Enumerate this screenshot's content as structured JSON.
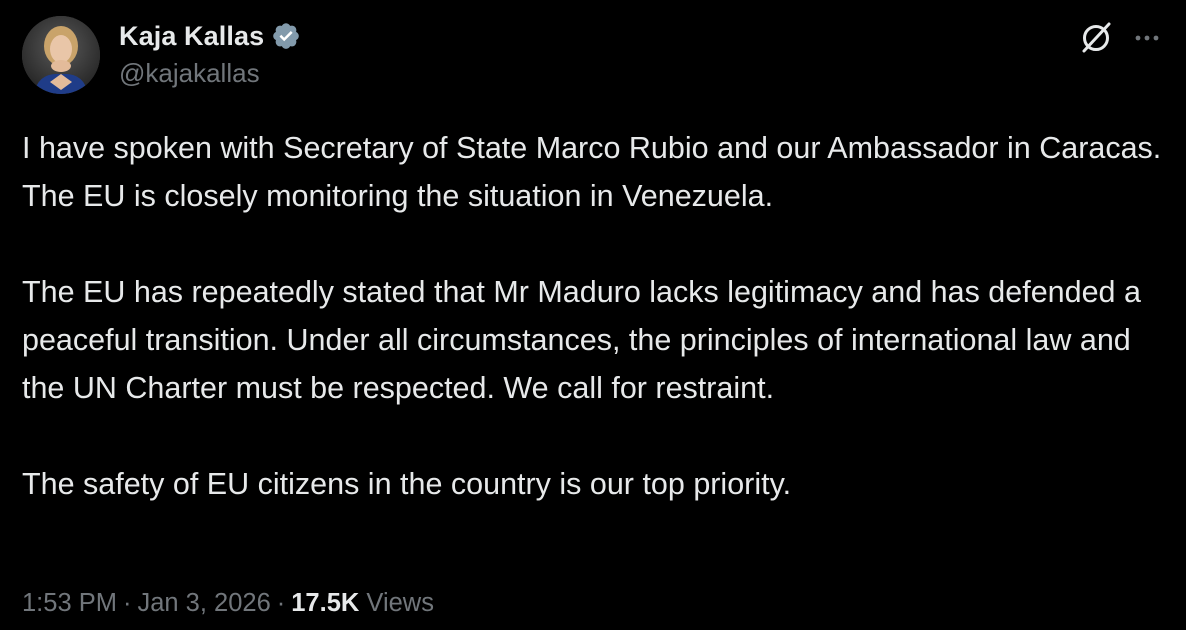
{
  "author": {
    "display_name": "Kaja Kallas",
    "handle": "@kajakallas",
    "verified": true
  },
  "tweet": {
    "paragraphs": [
      "I have spoken with Secretary of State Marco Rubio and our Ambassador in Caracas. The EU is closely monitoring the situation in Venezuela.",
      "The EU has repeatedly stated that Mr Maduro lacks legitimacy and has defended a peaceful transition. Under all circumstances, the principles of international law and the UN Charter must be respected. We call for restraint.",
      "The safety of EU citizens in the country is our top priority."
    ]
  },
  "meta": {
    "time": "1:53 PM",
    "separator": "·",
    "date": "Jan 3, 2026",
    "views_count": "17.5K",
    "views_label": "Views"
  },
  "icons": {
    "verified": "verified-badge-icon",
    "grok": "grok-icon",
    "more": "more-options-icon"
  },
  "colors": {
    "background": "#000000",
    "primary_text": "#e7e9ea",
    "secondary_text": "#71767b",
    "badge_fill": "#829aab"
  }
}
